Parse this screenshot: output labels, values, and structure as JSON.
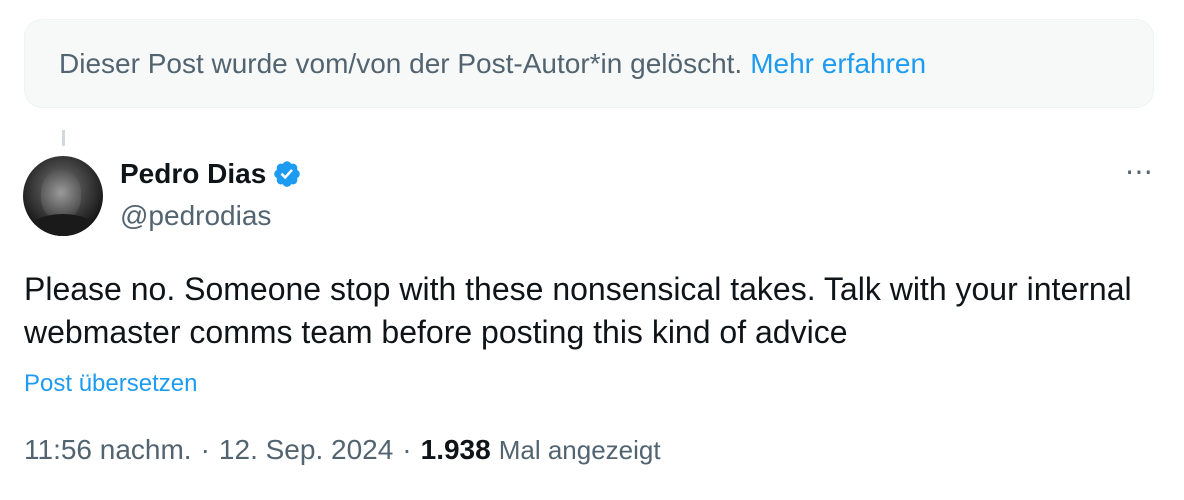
{
  "deleted_notice": {
    "text": "Dieser Post wurde vom/von der Post-Autor*in gelöscht.",
    "link": "Mehr erfahren"
  },
  "author": {
    "name": "Pedro Dias",
    "handle": "@pedrodias",
    "verified": true
  },
  "more_icon": "⋯",
  "tweet": {
    "text": "Please no. Someone stop with these nonsensical takes. Talk with your internal webmaster comms team before posting this kind of advice",
    "translate_link": "Post übersetzen"
  },
  "meta": {
    "time": "11:56 nachm.",
    "separator": "·",
    "date": "12. Sep. 2024",
    "views_count": "1.938",
    "views_label": "Mal angezeigt"
  },
  "colors": {
    "accent": "#1d9bf0",
    "secondary_text": "#536471",
    "primary_text": "#0f1419"
  }
}
